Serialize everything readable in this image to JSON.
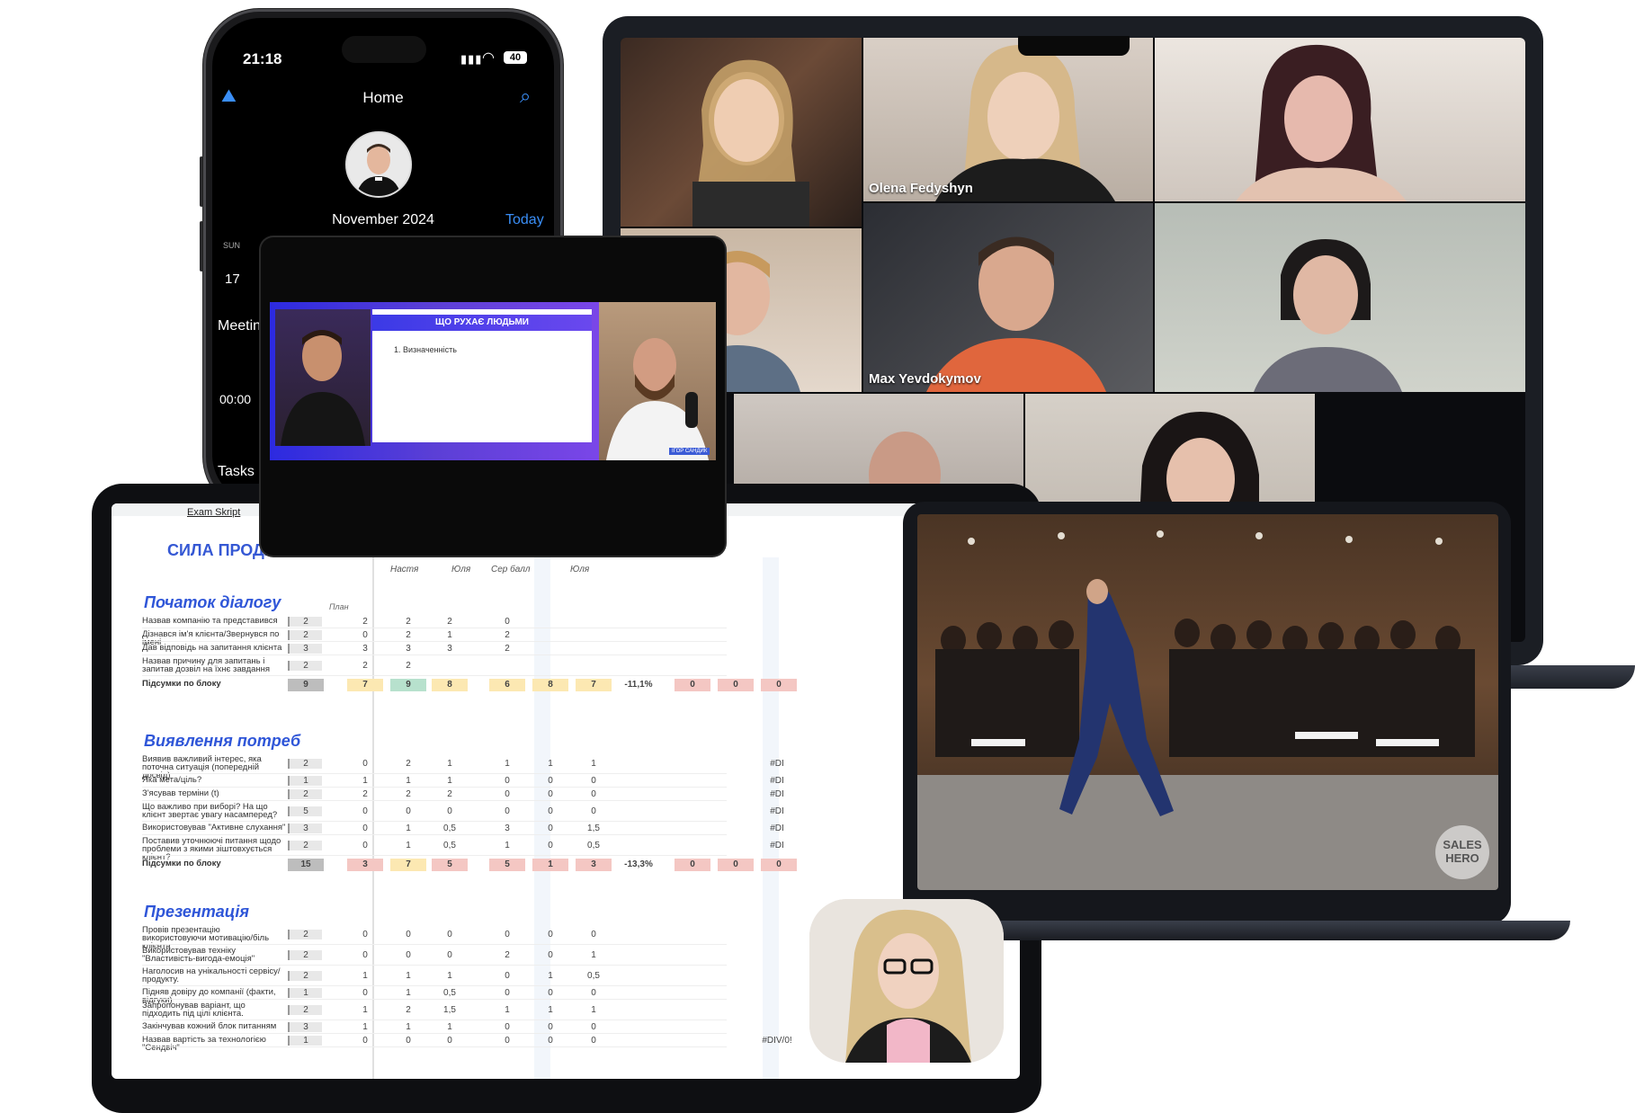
{
  "phone": {
    "time": "21:18",
    "battery": "40",
    "title": "Home",
    "month": "November 2024",
    "today": "Today",
    "weekday": "SUN",
    "day": "17",
    "meeting": "Meetin",
    "hour": "00:00",
    "tasks": "Tasks",
    "accent": "#3a8ef6"
  },
  "slide": {
    "title": "ЩО РУХАЄ ЛЮДЬМИ",
    "item": "1.    Визначенність",
    "speaker_tag": "ІГОР САНДИК"
  },
  "zoom": {
    "participants": [
      {
        "name": ""
      },
      {
        "name": "Olena Fedyshyn"
      },
      {
        "name": ""
      },
      {
        "name": ""
      },
      {
        "name": "Max Yevdokymov"
      },
      {
        "name": ""
      },
      {
        "name": ""
      },
      {
        "name": ""
      }
    ]
  },
  "stage_photo": {
    "watermark_line1": "SALES",
    "watermark_line2": "HERO"
  },
  "sheet": {
    "tab_name": "Exam Skript",
    "logo": "СИЛА ПРОДАЖ",
    "columns": [
      "Настя",
      "Юля",
      "Сер балл",
      "Юля"
    ],
    "plan_header": "План",
    "sections": [
      {
        "title": "Початок діалогу",
        "rows": [
          {
            "label": "Назвав компанію та представився",
            "plan": "2",
            "a": "2",
            "b": "2",
            "c": "2",
            "d": "0",
            "e": "",
            "f": "",
            "g": ""
          },
          {
            "label": "Дізнався ім'я клієнта/Звернувся по імені",
            "plan": "2",
            "a": "0",
            "b": "2",
            "c": "1",
            "d": "2",
            "e": "",
            "f": "",
            "g": ""
          },
          {
            "label": "Дав відповідь на запитання клієнта",
            "plan": "3",
            "a": "3",
            "b": "3",
            "c": "3",
            "d": "2",
            "e": "",
            "f": "",
            "g": ""
          },
          {
            "label": "Назвав причину для запитань і запитав дозвіл на їхнє завдання",
            "plan": "2",
            "a": "2",
            "b": "2",
            "c": "",
            "d": "",
            "e": "",
            "f": "",
            "g": ""
          }
        ],
        "total_label": "Підсумки по блоку",
        "total": {
          "plan": "9",
          "a": "7",
          "b": "9",
          "c": "8",
          "d": "6",
          "e": "8",
          "f": "7",
          "pct": "-11,1%",
          "x1": "0",
          "x2": "0",
          "x3": "0"
        }
      },
      {
        "title": "Виявлення потреб",
        "rows": [
          {
            "label": "Виявив важливий інтерес, яка поточна ситуація (попередній досвід)",
            "plan": "2",
            "a": "0",
            "b": "2",
            "c": "1",
            "d": "1",
            "e": "1",
            "f": "1",
            "g": "#DI"
          },
          {
            "label": "Яка мета/ціль?",
            "plan": "1",
            "a": "1",
            "b": "1",
            "c": "1",
            "d": "0",
            "e": "0",
            "f": "0",
            "g": "#DI"
          },
          {
            "label": "З'ясував терміни (t)",
            "plan": "2",
            "a": "2",
            "b": "2",
            "c": "2",
            "d": "0",
            "e": "0",
            "f": "0",
            "g": "#DI"
          },
          {
            "label": "Що важливо при виборі? На що клієнт звертає увагу насамперед?",
            "plan": "5",
            "a": "0",
            "b": "0",
            "c": "0",
            "d": "0",
            "e": "0",
            "f": "0",
            "g": "#DI"
          },
          {
            "label": "Використовував \"Активне слухання\"",
            "plan": "3",
            "a": "0",
            "b": "1",
            "c": "0,5",
            "d": "3",
            "e": "0",
            "f": "1,5",
            "g": "#DI"
          },
          {
            "label": "Поставив уточнюючі питання щодо проблеми з якими зіштовхується клієнт?",
            "plan": "2",
            "a": "0",
            "b": "1",
            "c": "0,5",
            "d": "1",
            "e": "0",
            "f": "0,5",
            "g": "#DI"
          }
        ],
        "total_label": "Підсумки по блоку",
        "total": {
          "plan": "15",
          "a": "3",
          "b": "7",
          "c": "5",
          "d": "5",
          "e": "1",
          "f": "3",
          "pct": "-13,3%",
          "x1": "0",
          "x2": "0",
          "x3": "0"
        }
      },
      {
        "title": "Презентація",
        "rows": [
          {
            "label": "Провів презентацію використовуючи мотивацію/біль клієнта",
            "plan": "2",
            "a": "0",
            "b": "0",
            "c": "0",
            "d": "0",
            "e": "0",
            "f": "0",
            "g": ""
          },
          {
            "label": "Використовував техніку \"Властивість-вигода-емоція\"",
            "plan": "2",
            "a": "0",
            "b": "0",
            "c": "0",
            "d": "2",
            "e": "0",
            "f": "1",
            "g": ""
          },
          {
            "label": "Наголосив на унікальності сервісу/продукту.",
            "plan": "2",
            "a": "1",
            "b": "1",
            "c": "1",
            "d": "0",
            "e": "1",
            "f": "0,5",
            "g": ""
          },
          {
            "label": "Підняв довіру до компанії (факти, відгуки)",
            "plan": "1",
            "a": "0",
            "b": "1",
            "c": "0,5",
            "d": "0",
            "e": "0",
            "f": "0",
            "g": ""
          },
          {
            "label": "Запропонував варіант, що підходить під цілі клієнта.",
            "plan": "2",
            "a": "1",
            "b": "2",
            "c": "1,5",
            "d": "1",
            "e": "1",
            "f": "1",
            "g": ""
          },
          {
            "label": "Закінчував кожний блок питанням",
            "plan": "3",
            "a": "1",
            "b": "1",
            "c": "1",
            "d": "0",
            "e": "0",
            "f": "0",
            "g": ""
          },
          {
            "label": "Назвав вартість за технологією \"Сендвіч\"",
            "plan": "1",
            "a": "0",
            "b": "0",
            "c": "0",
            "d": "0",
            "e": "0",
            "f": "0",
            "g": "#DIV/0!"
          }
        ]
      }
    ]
  },
  "colors": {
    "section_title": "#2f56d8",
    "red_cell": "#f4c7c3",
    "yellow_cell": "#fce8b2",
    "green_cell": "#b7e1cd"
  }
}
